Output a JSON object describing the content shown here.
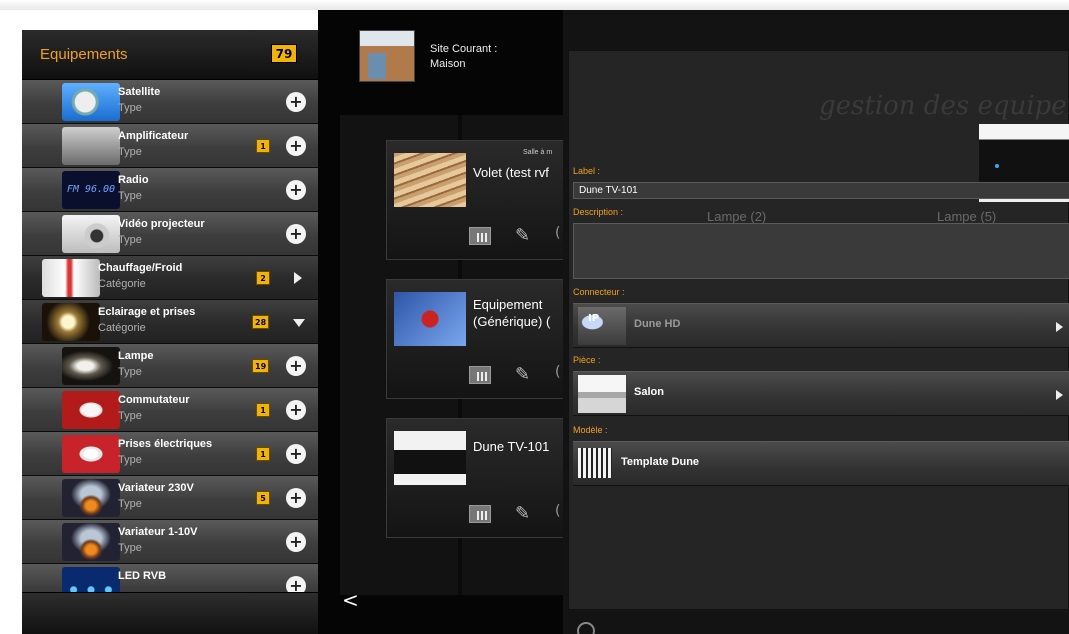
{
  "left_panel": {
    "title": "Equipements",
    "count": "79",
    "items": [
      {
        "name": "Satellite",
        "sub": "Type",
        "badge": "",
        "action": "plus",
        "level": 2,
        "icon": "satellite-dish"
      },
      {
        "name": "Amplificateur",
        "sub": "Type",
        "badge": "1",
        "action": "plus",
        "level": 2,
        "icon": "amplifier"
      },
      {
        "name": "Radio",
        "sub": "Type",
        "badge": "",
        "action": "plus",
        "level": 2,
        "icon": "radio-display",
        "thumb_text": "FM 96.00"
      },
      {
        "name": "Vidéo projecteur",
        "sub": "Type",
        "badge": "",
        "action": "plus",
        "level": 2,
        "icon": "projector"
      },
      {
        "name": "Chauffage/Froid",
        "sub": "Catégorie",
        "badge": "2",
        "action": "expand",
        "level": 1,
        "icon": "thermometer"
      },
      {
        "name": "Eclairage et prises",
        "sub": "Catégorie",
        "badge": "28",
        "action": "collapse",
        "level": 1,
        "icon": "light"
      },
      {
        "name": "Lampe",
        "sub": "Type",
        "badge": "19",
        "action": "plus",
        "level": 2,
        "icon": "lamp"
      },
      {
        "name": "Commutateur",
        "sub": "Type",
        "badge": "1",
        "action": "plus",
        "level": 2,
        "icon": "switch"
      },
      {
        "name": "Prises électriques",
        "sub": "Type",
        "badge": "1",
        "action": "plus",
        "level": 2,
        "icon": "power-outlet"
      },
      {
        "name": "Variateur 230V",
        "sub": "Type",
        "badge": "5",
        "action": "plus",
        "level": 2,
        "icon": "dimmer"
      },
      {
        "name": "Variateur 1-10V",
        "sub": "Type",
        "badge": "",
        "action": "plus",
        "level": 2,
        "icon": "dimmer"
      },
      {
        "name": "LED RVB",
        "sub": "",
        "badge": "",
        "action": "plus",
        "level": 2,
        "icon": "led-strip"
      }
    ]
  },
  "middle": {
    "site_label": "Site Courant :",
    "site_value": "Maison",
    "cards": [
      {
        "title": "Volet (test rvf",
        "room": "Salle à m",
        "icon": "wood-shutter"
      },
      {
        "title": "Equipement\n(Générique) (",
        "room": "",
        "icon": "swiss-knife"
      },
      {
        "title": "Dune TV-101",
        "room": "",
        "icon": "media-box"
      }
    ],
    "back": "<"
  },
  "right_panel": {
    "background_title": "gestion des equipeme",
    "bg_items": [
      "Lampe (2)",
      "Lampe (5)"
    ],
    "label_caption": "Label :",
    "label_value": "Dune TV-101",
    "description_caption": "Description :",
    "description_value": "",
    "connecteur_caption": "Connecteur :",
    "connecteur_value": "Dune HD",
    "connecteur_icon_text": "IP",
    "piece_caption": "Pièce :",
    "piece_value": "Salon",
    "modele_caption": "Modèle :",
    "modele_value": "Template Dune"
  },
  "colors": {
    "accent": "#f0a21a",
    "badge": "#f3b400",
    "panel": "#141414"
  }
}
